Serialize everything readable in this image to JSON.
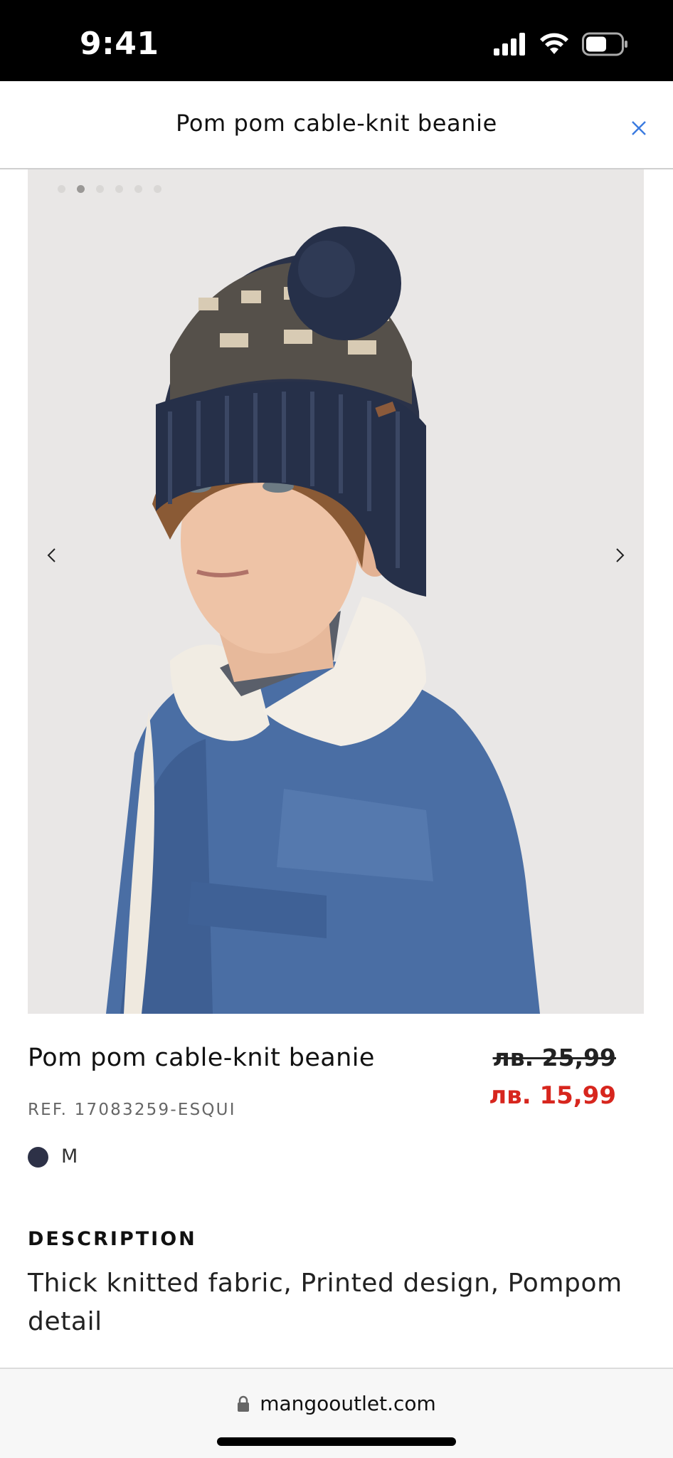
{
  "status_bar": {
    "time": "9:41",
    "icons": [
      "signal-icon",
      "wifi-icon",
      "battery-icon"
    ]
  },
  "header": {
    "title": "Pom pom cable-knit beanie",
    "close_icon": "close-icon"
  },
  "gallery": {
    "image_count": 6,
    "active_index": 1,
    "prev_icon": "chevron-left-icon",
    "next_icon": "chevron-right-icon"
  },
  "product": {
    "title": "Pom pom cable-knit beanie",
    "ref": "REF. 17083259-ESQUI",
    "price_old": "лв. 25,99",
    "price_new": "лв. 15,99",
    "color_hex": "#2d3147",
    "size": "M"
  },
  "description": {
    "heading": "DESCRIPTION",
    "text": "Thick knitted fabric, Printed design, Pompom detail"
  },
  "browser": {
    "url": "mangooutlet.com",
    "lock_icon": "lock-icon"
  },
  "colors": {
    "sale_red": "#d7261e",
    "status_bar": "#000000",
    "accent_blue": "#3b7be0"
  }
}
